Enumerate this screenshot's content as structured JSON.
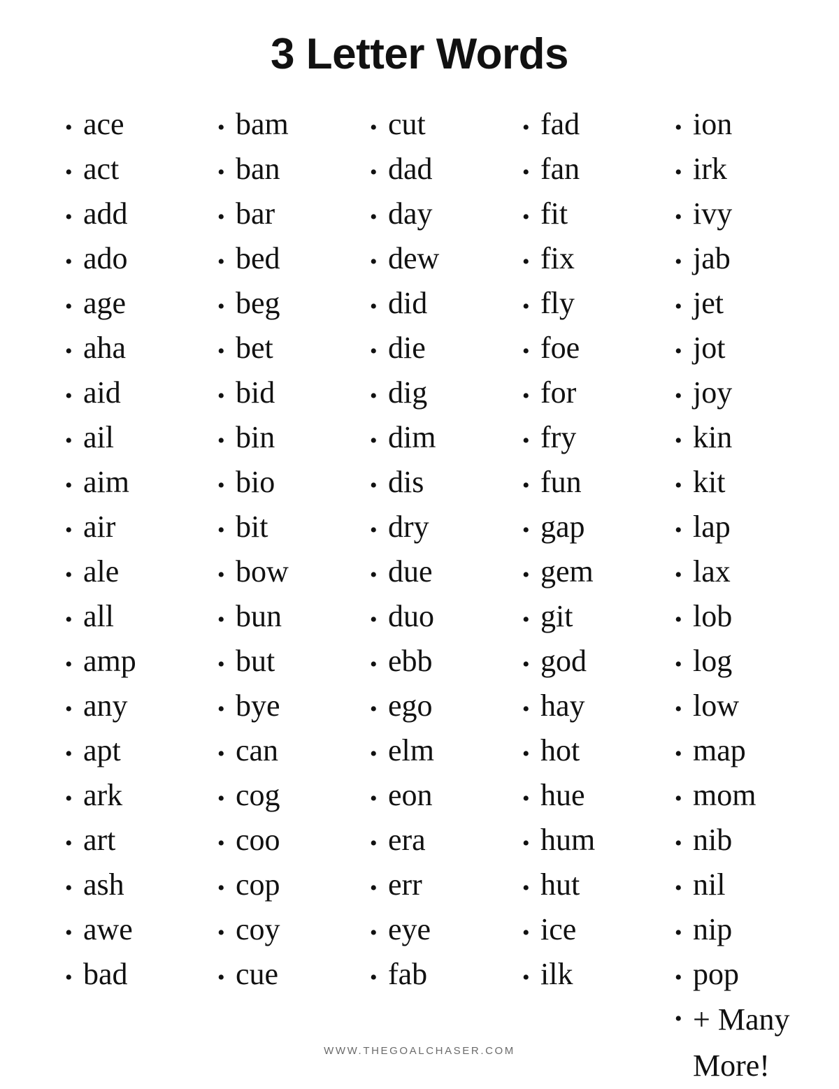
{
  "page": {
    "title": "3 Letter Words",
    "background_color": "#ffffff",
    "text_color": "#111111"
  },
  "footer": {
    "url": "WWW.THEGOALCHASER.COM",
    "color": "#6b6b6b"
  },
  "bullet": {
    "glyph": "•"
  },
  "columns": [
    {
      "index": 1,
      "words": [
        "ace",
        "act",
        "add",
        "ado",
        "age",
        "aha",
        "aid",
        "ail",
        "aim",
        "air",
        "ale",
        "all",
        "amp",
        "any",
        "apt",
        "ark",
        "art",
        "ash",
        "awe",
        "bad"
      ]
    },
    {
      "index": 2,
      "words": [
        "bam",
        "ban",
        "bar",
        "bed",
        "beg",
        "bet",
        "bid",
        "bin",
        "bio",
        "bit",
        "bow",
        "bun",
        "but",
        "bye",
        "can",
        "cog",
        "coo",
        "cop",
        "coy",
        "cue"
      ]
    },
    {
      "index": 3,
      "words": [
        "cut",
        "dad",
        "day",
        "dew",
        "did",
        "die",
        "dig",
        "dim",
        "dis",
        "dry",
        "due",
        "duo",
        "ebb",
        "ego",
        "elm",
        "eon",
        "era",
        "err",
        "eye",
        "fab"
      ]
    },
    {
      "index": 4,
      "words": [
        "fad",
        "fan",
        "fit",
        "fix",
        "fly",
        "foe",
        "for",
        "fry",
        "fun",
        "gap",
        "gem",
        "git",
        "god",
        "hay",
        "hot",
        "hue",
        "hum",
        "hut",
        "ice",
        "ilk"
      ]
    },
    {
      "index": 5,
      "words": [
        "ion",
        "irk",
        "ivy",
        "jab",
        "jet",
        "jot",
        "joy",
        "kin",
        "kit",
        "lap",
        "lax",
        "lob",
        "log",
        "low",
        "map",
        "mom",
        "nib",
        "nil",
        "nip",
        "pop",
        "+ Many More!"
      ]
    }
  ]
}
